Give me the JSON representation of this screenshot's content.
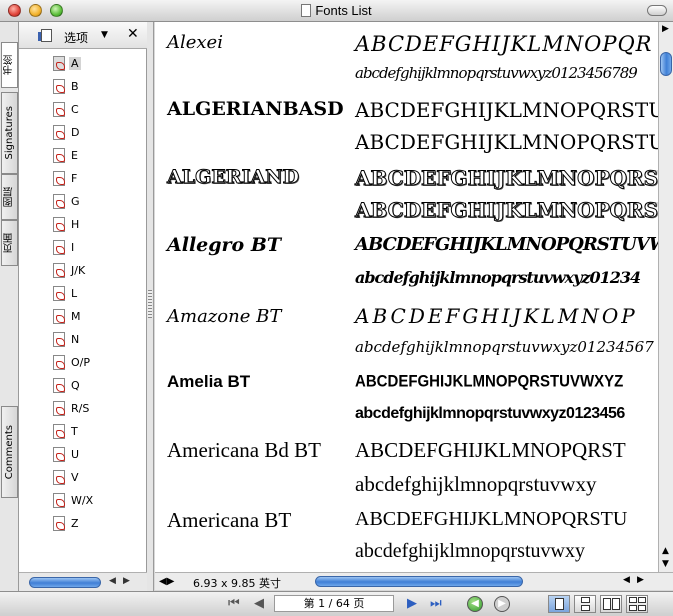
{
  "window": {
    "title": "Fonts List"
  },
  "vtabs": [
    {
      "label": "书签"
    },
    {
      "label": "Signatures"
    },
    {
      "label": "图层"
    },
    {
      "label": "页面"
    },
    {
      "label": "Comments"
    }
  ],
  "sidebar": {
    "options_label": "选项",
    "close_label": "✕",
    "bookmarks": [
      "A",
      "B",
      "C",
      "D",
      "E",
      "F",
      "G",
      "H",
      "I",
      "J/K",
      "L",
      "M",
      "N",
      "O/P",
      "Q",
      "R/S",
      "T",
      "U",
      "V",
      "W/X",
      "Z"
    ]
  },
  "fonts": [
    {
      "name": "Alexei",
      "upper": "ABCDEFGHIJKLMNOPQR",
      "lower": "abcdefghijklmnopqrstuvwxyz0123456789"
    },
    {
      "name": "ALGERIANBASD",
      "upper": "ABCDEFGHIJKLMNOPQRSTUVW",
      "lower": "ABCDEFGHIJKLMNOPQRSTUVW"
    },
    {
      "name": "ALGERIAND",
      "upper": "ABCDEFGHIJKLMNOPQRSTUVW",
      "lower": "ABCDEFGHIJKLMNOPQRSTUVW"
    },
    {
      "name": "Allegro BT",
      "upper": "ABCDEFGHIJKLMNOPQRSTUVWXYZ",
      "lower": "abcdefghijklmnopqrstuvwxyz01234"
    },
    {
      "name": "Amazone BT",
      "upper": "ABCDEFGHIJKLMNOP",
      "lower": "abcdefghijklmnopqrstuvwxyz01234567"
    },
    {
      "name": "Amelia BT",
      "upper": "ABCDEFGHIJKLMNOPQRSTUVWXYZ",
      "lower": "abcdefghijklmnopqrstuvwxyz0123456"
    },
    {
      "name": "Americana Bd BT",
      "upper": "ABCDEFGHIJKLMNOPQRST",
      "lower": "abcdefghijklmnopqrstuvwxy"
    },
    {
      "name": "Americana BT",
      "upper": "ABCDEFGHIJKLMNOPQRSTU",
      "lower": "abcdefghijklmnopqrstuvwxy"
    }
  ],
  "docbar": {
    "page_size": "6.93 x 9.85 英寸"
  },
  "toolbar": {
    "page_indicator": "第 1 / 64 页"
  }
}
